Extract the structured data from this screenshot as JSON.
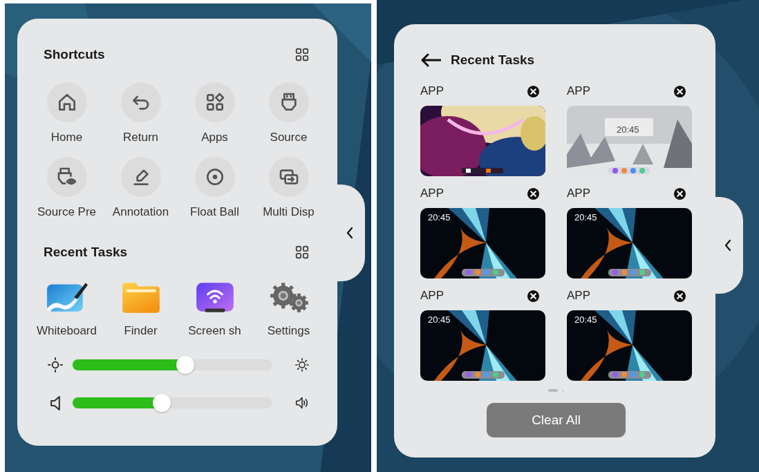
{
  "shortcuts_panel": {
    "shortcuts": {
      "title": "Shortcuts",
      "items": [
        {
          "label": "Home"
        },
        {
          "label": "Return"
        },
        {
          "label": "Apps"
        },
        {
          "label": "Source"
        },
        {
          "label": "Source Pre"
        },
        {
          "label": "Annotation"
        },
        {
          "label": "Float Ball"
        },
        {
          "label": "Multi Disp"
        }
      ]
    },
    "recent_tasks": {
      "title": "Recent Tasks",
      "apps": [
        {
          "label": "Whiteboard"
        },
        {
          "label": "Finder"
        },
        {
          "label": "Screen sh"
        },
        {
          "label": "Settings"
        }
      ]
    },
    "sliders": [
      {
        "kind": "brightness",
        "level": 0.56
      },
      {
        "kind": "volume",
        "level": 0.45
      }
    ]
  },
  "recent_tasks_panel": {
    "title": "Recent Tasks",
    "tasks": [
      {
        "label": "APP",
        "kind": "picture"
      },
      {
        "label": "APP",
        "kind": "picture",
        "clock": "20:45"
      },
      {
        "label": "APP",
        "kind": "picture",
        "clock": "20:45"
      },
      {
        "label": "APP",
        "kind": "picture",
        "clock": "20:45"
      },
      {
        "label": "APP",
        "kind": "picture",
        "clock": "20:45"
      },
      {
        "label": "APP",
        "kind": "picture",
        "clock": "20:45"
      }
    ],
    "pager": [
      {
        "selected": true
      },
      {
        "selected": false
      }
    ],
    "clear_button": "Clear All"
  }
}
